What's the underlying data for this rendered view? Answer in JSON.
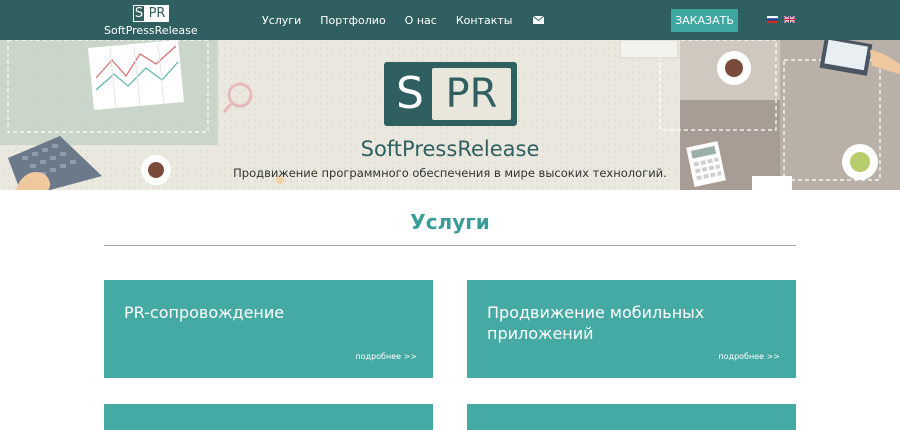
{
  "brand": {
    "mark_left": "S",
    "mark_right": "PR",
    "name": "SoftPressRelease"
  },
  "nav": {
    "items": [
      {
        "label": "Услуги"
      },
      {
        "label": "Портфолио"
      },
      {
        "label": "О нас"
      },
      {
        "label": "Контакты"
      }
    ],
    "order_label": "ЗАКАЗАТЬ"
  },
  "hero": {
    "logo_left": "S",
    "logo_right": "PR",
    "title": "SoftPressRelease",
    "subtitle": "Продвижение программного обеспечения в мире высоких технологий."
  },
  "services": {
    "title": "Услуги",
    "cards": [
      {
        "title": "PR-сопровождение",
        "more": "подробнее >>"
      },
      {
        "title": "Продвижение мобильных приложений",
        "more": "подробнее >>"
      },
      {
        "title": "",
        "more": ""
      },
      {
        "title": "",
        "more": ""
      }
    ]
  },
  "colors": {
    "navbar": "#2f5f60",
    "accent": "#45aaa4",
    "heading": "#3a9c97"
  },
  "icons": {
    "mail": "envelope-icon",
    "flag_ru": "russia-flag-icon",
    "flag_en": "uk-flag-icon"
  }
}
